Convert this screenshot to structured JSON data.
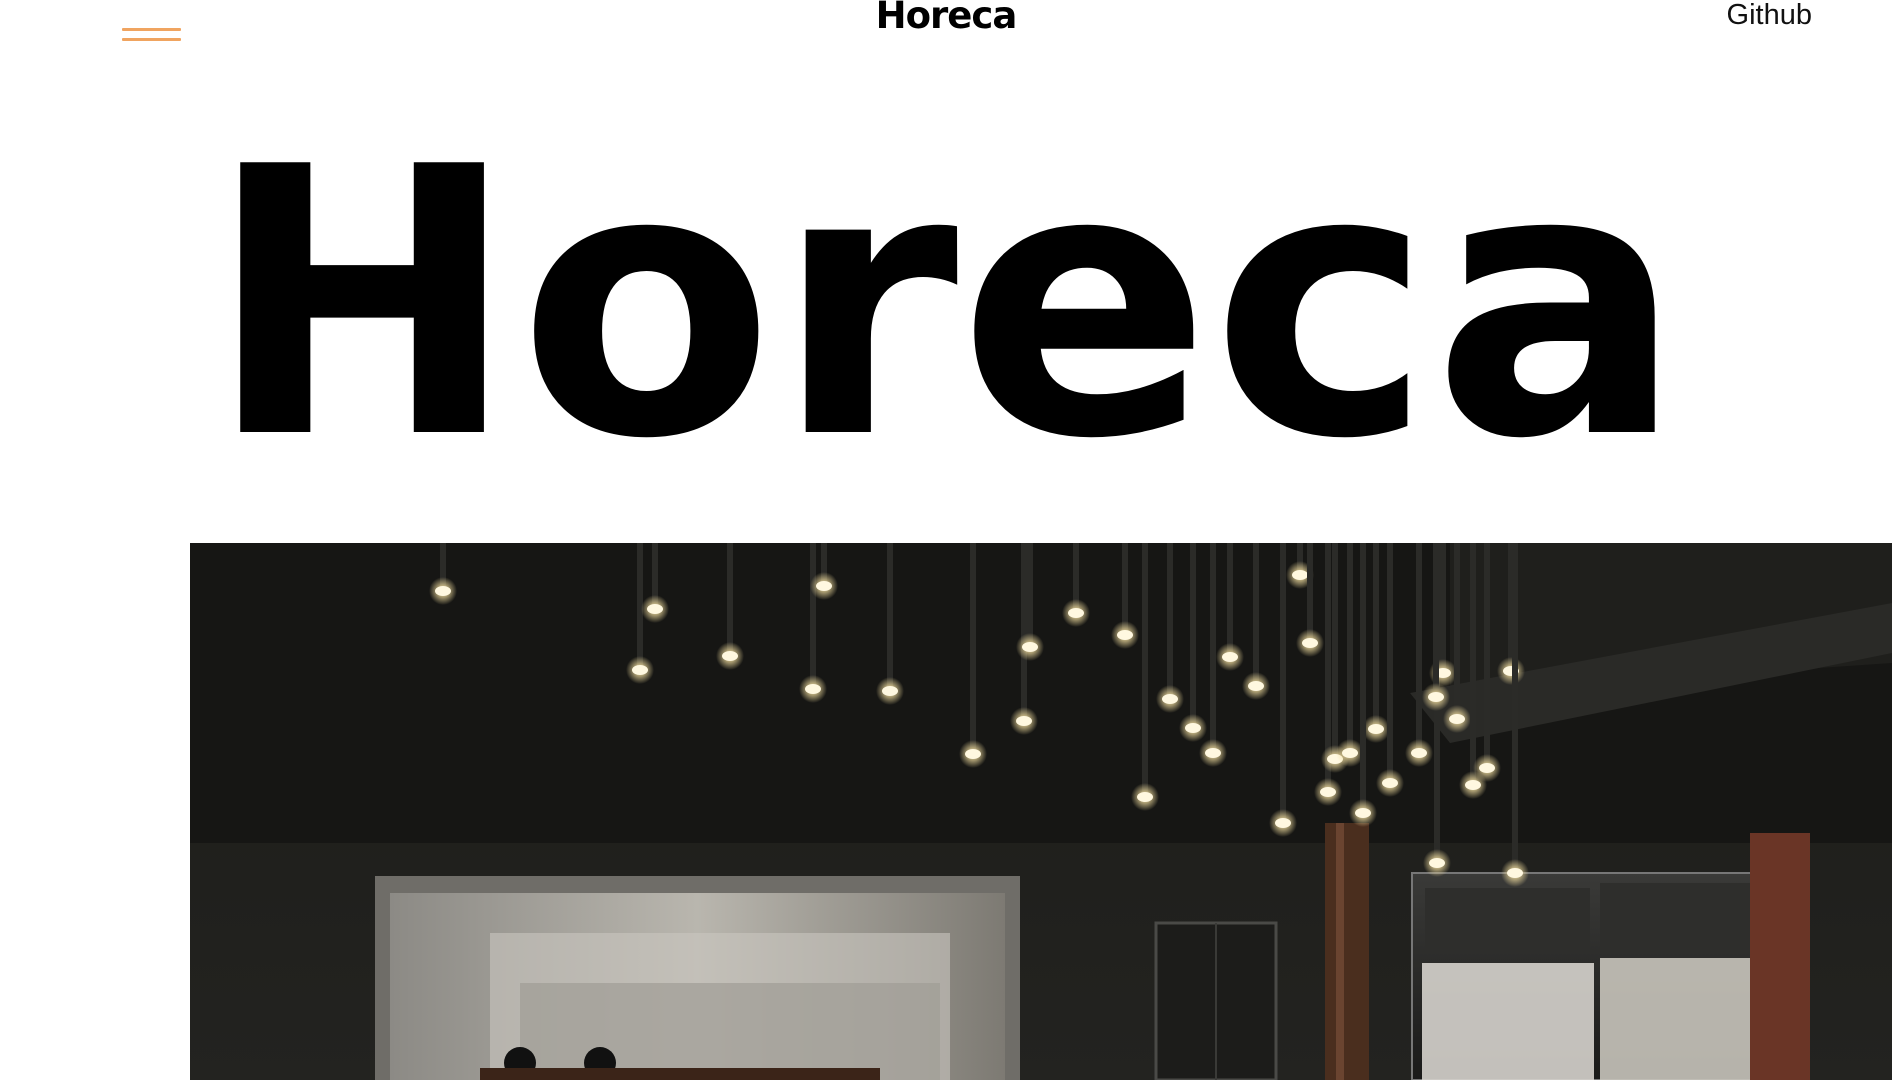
{
  "header": {
    "menu_icon": "hamburger-menu-icon",
    "logo": "Horeca",
    "github_label": "Github"
  },
  "hero": {
    "title": "Horeca",
    "image_alt": "restaurant-interior-photo"
  },
  "colors": {
    "accent": "#f0a460",
    "text": "#000000",
    "background": "#ffffff"
  }
}
